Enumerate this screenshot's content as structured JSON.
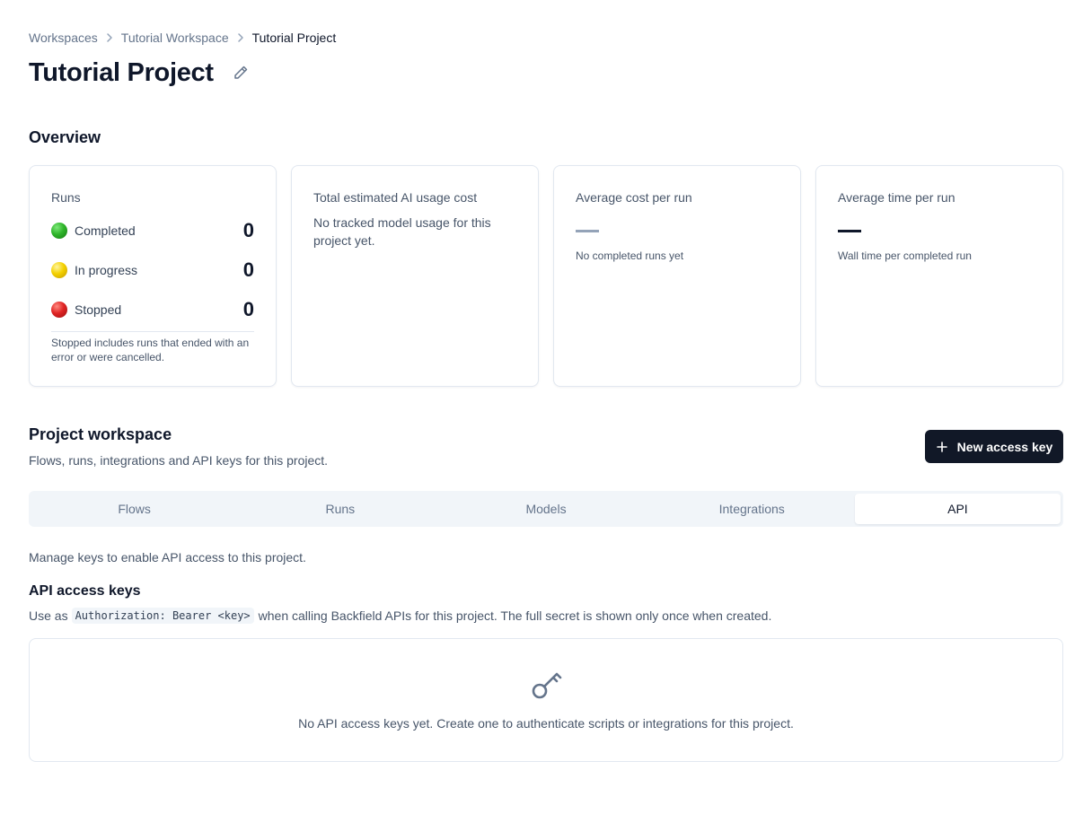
{
  "breadcrumb": {
    "items": [
      "Workspaces",
      "Tutorial Workspace"
    ],
    "current": "Tutorial Project"
  },
  "page": {
    "title": "Tutorial Project"
  },
  "overview": {
    "title": "Overview",
    "runs": {
      "label": "Runs",
      "completed_label": "Completed",
      "completed_count": "0",
      "in_progress_label": "In progress",
      "in_progress_count": "0",
      "stopped_label": "Stopped",
      "stopped_count": "0",
      "note": "Stopped includes runs that ended with an error or were cancelled."
    },
    "cost": {
      "label": "Total estimated AI usage cost",
      "body": "No tracked model usage for this project yet."
    },
    "avg_cost": {
      "label": "Average cost per run",
      "sub": "No completed runs yet"
    },
    "avg_time": {
      "label": "Average time per run",
      "sub": "Wall time per completed run"
    }
  },
  "project_workspace": {
    "title": "Project workspace",
    "subtitle": "Flows, runs, integrations and API keys for this project.",
    "new_key_label": "New access key"
  },
  "tabs": [
    "Flows",
    "Runs",
    "Models",
    "Integrations",
    "API"
  ],
  "active_tab": "API",
  "api": {
    "description": "Manage keys to enable API access to this project.",
    "heading": "API access keys",
    "usage_prefix": "Use as",
    "usage_code": "Authorization: Bearer <key>",
    "usage_suffix": "when calling Backfield APIs for this project. The full secret is shown only once when created.",
    "empty_text": "No API access keys yet. Create one to authenticate scripts or integrations for this project."
  },
  "colors": {
    "primary_button": "#111827",
    "completed": "#2fb52a",
    "in_progress": "#f4d100",
    "stopped": "#e02424",
    "avg_cost_dash": "#94a3b8",
    "avg_time_dash": "#0f172a"
  },
  "icons": [
    "chevron-right-icon",
    "pencil-icon",
    "plus-icon",
    "key-icon"
  ]
}
